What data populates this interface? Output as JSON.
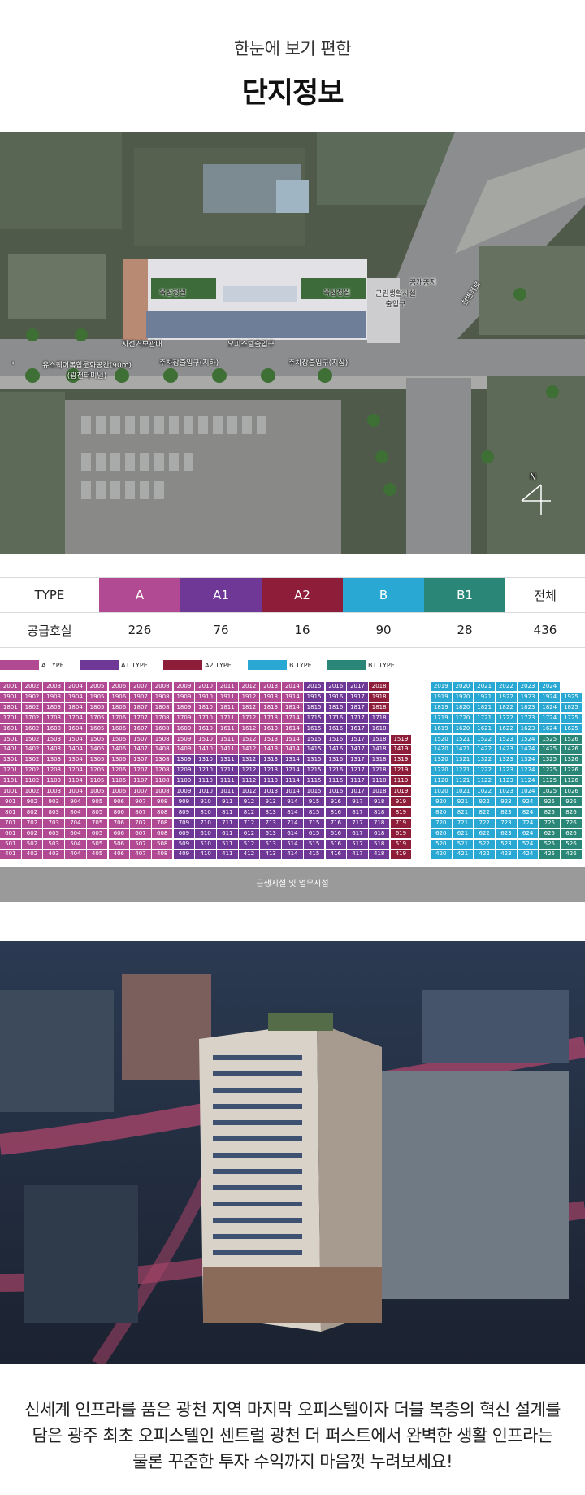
{
  "header": {
    "subtitle": "한눈에 보기 편한",
    "title": "단지정보"
  },
  "site_map": {
    "labels": {
      "rooftop_garden_left": "옥상정원",
      "rooftop_garden_right": "옥상정원",
      "public_space": "공개공지",
      "neighborhood_entrance": "근린생활시설\n출입구",
      "road_name": "천변좌로",
      "bicycle_storage": "자전거보관대",
      "officetel_entrance": "오피스텔출입구",
      "parking_left": "주차장출입구(지하)",
      "parking_right": "주차장출입구(지상)",
      "culture_space": "유스퀘어복합문화공간(90m)\n(광천터미널)",
      "compass_n": "N"
    }
  },
  "type_table": {
    "header_label": "TYPE",
    "row_label": "공급호실",
    "types": [
      {
        "name": "A",
        "count": "226",
        "color": "#b24a93"
      },
      {
        "name": "A1",
        "count": "76",
        "color": "#6f3896"
      },
      {
        "name": "A2",
        "count": "16",
        "color": "#8e1d3a"
      },
      {
        "name": "B",
        "count": "90",
        "color": "#2aa8d4"
      },
      {
        "name": "B1",
        "count": "28",
        "color": "#2a8778"
      }
    ],
    "total_label": "전체",
    "total_count": "436"
  },
  "legend": [
    {
      "label": "A TYPE",
      "color": "#b24a93"
    },
    {
      "label": "A1 TYPE",
      "color": "#6f3896"
    },
    {
      "label": "A2 TYPE",
      "color": "#8e1d3a"
    },
    {
      "label": "B TYPE",
      "color": "#2aa8d4"
    },
    {
      "label": "B1 TYPE",
      "color": "#2a8778"
    }
  ],
  "unit_grid": {
    "floors": [
      20,
      19,
      18,
      17,
      16,
      15,
      14,
      13,
      12,
      11,
      10,
      9,
      8,
      7,
      6,
      5,
      4
    ],
    "colors": {
      "A": "#b24a93",
      "A1": "#6f3896",
      "A2": "#8e1d3a",
      "B": "#2aa8d4",
      "B1": "#2a8778"
    },
    "retail_label": "근생시설 및 업무시설"
  },
  "caption": {
    "lines": [
      "신세계 인프라를 품은 광천 지역 마지막 오피스텔이자 더블 복층의 혁신 설계를",
      "담은 광주 최초 오피스텔인 센트럴 광천 더 퍼스트에서 완벽한 생활 인프라는",
      "물론 꾸준한 투자 수익까지 마음껏 누려보세요!"
    ]
  }
}
